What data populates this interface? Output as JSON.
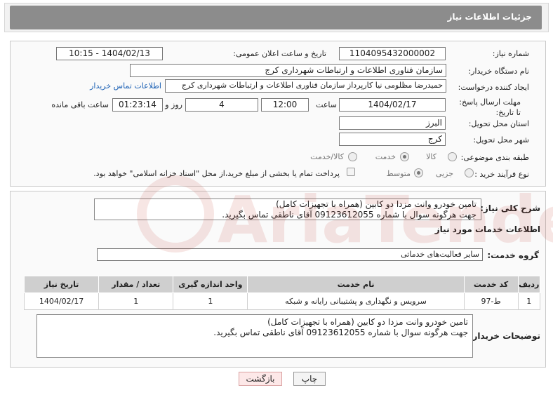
{
  "header": {
    "title": "جزئیات اطلاعات نیاز"
  },
  "fields": {
    "need_number_label": "شماره نیاز:",
    "need_number": "1104095432000002",
    "announce_label": "تاریخ و ساعت اعلان عمومی:",
    "announce_value": "1404/02/13 - 10:15",
    "buyer_org_label": "نام دستگاه خریدار:",
    "buyer_org": "سازمان فناوری اطلاعات و ارتباطات شهرداری کرج",
    "requester_label": "ایجاد کننده درخواست:",
    "requester": "حمیدرضا مظلومی نیا کارپرداز سازمان فناوری اطلاعات و ارتباطات شهرداری کرج",
    "buyer_contact_link": "اطلاعات تماس خریدار",
    "deadline_label": "مهلت ارسال پاسخ: تا تاریخ:",
    "deadline_date": "1404/02/17",
    "time_label": "ساعت",
    "deadline_time": "12:00",
    "days_value": "4",
    "days_label": "روز و",
    "remaining_time": "01:23:14",
    "remaining_label": "ساعت باقی مانده",
    "province_label": "استان محل تحویل:",
    "province": "البرز",
    "city_label": "شهر محل تحویل:",
    "city": "کرج",
    "category_label": "طبقه بندی موضوعی:",
    "category_options": [
      "کالا",
      "خدمت",
      "کالا/خدمت"
    ],
    "category_selected": "خدمت",
    "purchase_type_label": "نوع فرآیند خرید :",
    "purchase_options": [
      "جزیی",
      "متوسط"
    ],
    "purchase_selected": "متوسط",
    "payment_note": "پرداخت تمام یا بخشی از مبلغ خرید،از محل \"اسناد خزانه اسلامی\" خواهد بود."
  },
  "summary": {
    "label": "شرح کلی نیاز:",
    "text": "تامین خودرو وانت مزدا دو کابین (همراه با تجهیزات کامل)\nجهت هرگونه سوال با شماره 09123612055 آقای ناطقی تماس بگیرید."
  },
  "services": {
    "section_title": "اطلاعات خدمات مورد نیاز",
    "group_label": "گروه خدمت:",
    "group_value": "سایر فعالیت‌های خدماتی",
    "columns": [
      "ردیف",
      "کد خدمت",
      "نام خدمت",
      "واحد اندازه گیری",
      "تعداد / مقدار",
      "تاریخ نیاز"
    ],
    "rows": [
      [
        "1",
        "ط-97",
        "سرویس و نگهداری و پشتیبانی رایانه و شبکه",
        "1",
        "1",
        "1404/02/17"
      ]
    ]
  },
  "buyer_notes": {
    "label": "توضیحات خریدار:",
    "text": "تامین خودرو وانت مزدا دو کابین (همراه با تجهیزات کامل)\nجهت هرگونه سوال با شماره 09123612055 آقای ناطقی تماس بگیرید."
  },
  "buttons": {
    "print": "چاپ",
    "back": "بازگشت"
  },
  "watermark": {
    "text": "AriaTender.net",
    "color": "#c0392b"
  }
}
